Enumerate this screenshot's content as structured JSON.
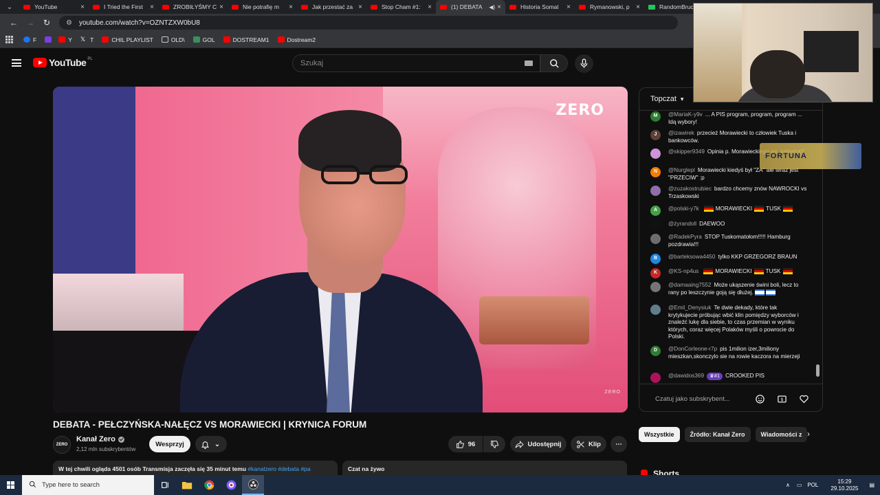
{
  "browser": {
    "tabs": [
      {
        "label": "YouTube",
        "favicon": "youtube",
        "active": false
      },
      {
        "label": "I Tried the First",
        "favicon": "youtube",
        "active": false
      },
      {
        "label": "ZROBIŁYŚMY C",
        "favicon": "youtube",
        "active": false
      },
      {
        "label": "Nie potrafię m",
        "favicon": "youtube",
        "active": false
      },
      {
        "label": "Jak przestać za",
        "favicon": "youtube",
        "active": false
      },
      {
        "label": "Stop Cham #1:",
        "favicon": "youtube",
        "active": false
      },
      {
        "label": "(1) DEBATA",
        "favicon": "youtube",
        "active": true,
        "audio": true
      },
      {
        "label": "Historia Somal",
        "favicon": "youtube",
        "active": false
      },
      {
        "label": "Rymanowski, p",
        "favicon": "youtube",
        "active": false
      },
      {
        "label": "RandomBruce",
        "favicon": "green",
        "active": false
      }
    ],
    "url": "youtube.com/watch?v=OZNTZXW0bU8",
    "bookmarks": [
      {
        "label": "F",
        "icon": "facebook"
      },
      {
        "label": "",
        "icon": "twitch"
      },
      {
        "label": "Y",
        "icon": "youtube"
      },
      {
        "label": "T",
        "icon": "x"
      },
      {
        "label": "CHIL PLAYLIST",
        "icon": "youtube"
      },
      {
        "label": "OLD\\",
        "icon": "folder"
      },
      {
        "label": "GOL",
        "icon": "g"
      },
      {
        "label": "DOSTREAM1",
        "icon": "youtube"
      },
      {
        "label": "Dostream2",
        "icon": "youtube"
      }
    ]
  },
  "youtube": {
    "logo_text": "YouTube",
    "logo_country": "PL",
    "search_placeholder": "Szukaj",
    "video": {
      "watermark": "ZERO",
      "watermark_small": "ZERO",
      "title": "DEBATA - PEŁCZYŃSKA-NAŁĘCZ VS MORAWIECKI | KRYNICA FORUM"
    },
    "channel": {
      "logo_text": "ZERO",
      "name": "Kanał Zero",
      "subscribers": "2,12 mln subskrybentów",
      "support_label": "Wesprzyj"
    },
    "actions": {
      "likes": "96",
      "share": "Udostępnij",
      "clip": "Klip"
    },
    "description": {
      "text": "W tej chwili ogląda 4501 osób  Transmisja zaczęła się 35 minut temu",
      "tags": "#kanalzero #debata #pa"
    },
    "live_chat_panel_label": "Czat na żywo",
    "chat": {
      "mode": "Topczat",
      "input_placeholder": "Czatuj jako subskrybent...",
      "messages": [
        {
          "user": "@MariaK-y9v",
          "text": "... A PIS program, program, program ... Idą wybory!",
          "avatar": "M",
          "color": "#2e7d32"
        },
        {
          "user": "@izawirek",
          "text": "przecież Morawiecki to człowiek Tuska i bankowców.",
          "avatar": "J",
          "color": "#5d4037"
        },
        {
          "user": "@skipper9349",
          "text": "Opinia p. Morawieckiego ws. katastra?",
          "avatar": "",
          "color": "#ce93d8"
        },
        {
          "user": "@Nurglepl",
          "text": "Morawiecki kiedyś był \"ZA\" ale teraz jest \"PRZECIW\" :p",
          "avatar": "N",
          "color": "#f57c00"
        },
        {
          "user": "@zuzakostrubiec",
          "text": "bardzo chcemy znów NAWROCKI vs Trzaskowski",
          "avatar": "",
          "color": "#8e6fa8"
        },
        {
          "user": "@polski-y7k",
          "text": "MORAWIECKI",
          "text2": "TUSK",
          "flags": true,
          "avatar": "A",
          "color": "#43a047"
        },
        {
          "user": "@żyrandoll",
          "text": "DAEWOO",
          "avatar": "",
          "color": "#111111"
        },
        {
          "user": "@RadekPyra",
          "text": "STOP Tuskomatołom!!!!! Hamburg pozdrawia!!!",
          "avatar": "",
          "color": "#6d6d6d"
        },
        {
          "user": "@barteksowa4450",
          "text": "tylko KKP GRZEGORZ BRAUN",
          "avatar": "B",
          "color": "#1e88e5"
        },
        {
          "user": "@KS-np4us",
          "text": "MORAWIECKI",
          "text2": "TUSK",
          "flags": true,
          "avatar": "K",
          "color": "#c62828"
        },
        {
          "user": "@damaaing7552",
          "text": "Może ukąszenie świni boli, lecz to rany po leszczynie goją się dłużej.",
          "avatar": "",
          "color": "#757575",
          "flags_il": true
        },
        {
          "user": "@Emil_Denysiuk",
          "text": "Te dwie dekady, które tak krytykujecie próbując wbić klin pomiędzy wyborców i znaleźć lukę dla siebie, to czas przemian w wyniku których, coraz więcej Polaków myśli o powrocie do Polski.",
          "avatar": "",
          "color": "#607d8b"
        },
        {
          "user": "@DonCorleone-r7p",
          "text": "pis 1milion izer,3miliony mieszkan,skonczylo sie na rowie kaczora na mierzeji",
          "avatar": "D",
          "color": "#2e7d32"
        },
        {
          "user": "@dawidos369",
          "text": "CROOKED PIS",
          "badge": "#1",
          "avatar": "",
          "color": "#ad1457"
        }
      ],
      "overlay_banner": "FORTUNA"
    },
    "chips": [
      "Wszystkie",
      "Źródło: Kanał Zero",
      "Wiadomości z"
    ],
    "shorts_label": "Shorts"
  },
  "taskbar": {
    "search_placeholder": "Type here to search",
    "language": "POL",
    "time": "15:29",
    "date": "29.10.2025"
  }
}
